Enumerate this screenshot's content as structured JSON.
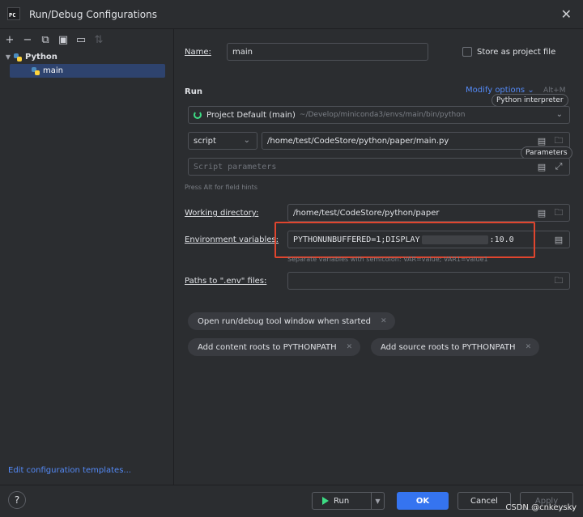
{
  "window": {
    "title": "Run/Debug Configurations",
    "app_icon_text": "PC"
  },
  "sidebar": {
    "tree": {
      "parent": "Python",
      "child": "main"
    },
    "edit_templates": "Edit configuration templates..."
  },
  "form": {
    "name_label": "Name:",
    "name_value": "main",
    "store_label": "Store as project file",
    "run_section": "Run",
    "modify_options": "Modify options",
    "modify_shortcut": "Alt+M",
    "tooltip_interpreter": "Python interpreter",
    "tooltip_parameters": "Parameters",
    "interpreter_name": "Project Default (main)",
    "interpreter_path": "~/Develop/miniconda3/envs/main/bin/python",
    "script_type": "script",
    "script_path": "/home/test/CodeStore/python/paper/main.py",
    "script_params_placeholder": "Script parameters",
    "field_hint": "Press Alt for field hints",
    "workdir_label": "Working directory:",
    "workdir_value": "/home/test/CodeStore/python/paper",
    "env_label": "Environment variables:",
    "env_value_start": "PYTHONUNBUFFERED=1;DISPLAY",
    "env_value_end": ":10.0",
    "env_hint": "Separate variables with semicolon: VAR=value; VAR1=value1",
    "dotenv_label": "Paths to \".env\" files:",
    "chip_open_tool": "Open run/debug tool window when started",
    "chip_content_roots": "Add content roots to PYTHONPATH",
    "chip_source_roots": "Add source roots to PYTHONPATH"
  },
  "footer": {
    "help": "?",
    "run": "Run",
    "ok": "OK",
    "cancel": "Cancel",
    "apply": "Apply"
  },
  "watermark": "CSDN @cnkeysky"
}
